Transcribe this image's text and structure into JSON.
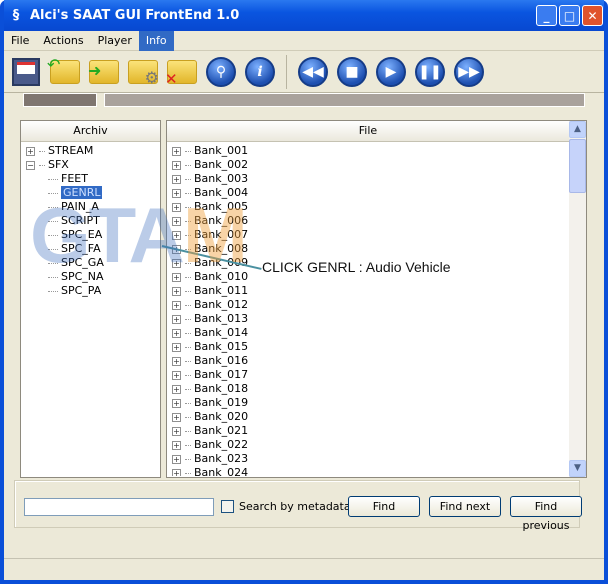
{
  "window": {
    "title": "Alci's SAAT GUI FrontEnd 1.0"
  },
  "menu": [
    "File",
    "Actions",
    "Player",
    "Info"
  ],
  "menu_active": "Info",
  "toolbar": [
    "save-icon",
    "open-folder-icon",
    "folder-arrow-icon",
    "folder-settings-icon",
    "folder-delete-icon",
    "search-icon",
    "info-icon",
    "rewind-icon",
    "stop-icon",
    "play-icon",
    "pause-icon",
    "fast-forward-icon"
  ],
  "archive": {
    "header": "Archiv",
    "items": [
      {
        "label": "STREAM",
        "level": 0,
        "toggle": "+"
      },
      {
        "label": "SFX",
        "level": 0,
        "toggle": "-"
      },
      {
        "label": "FEET",
        "level": 1
      },
      {
        "label": "GENRL",
        "level": 1,
        "selected": true
      },
      {
        "label": "PAIN_A",
        "level": 1
      },
      {
        "label": "SCRIPT",
        "level": 1
      },
      {
        "label": "SPC_EA",
        "level": 1
      },
      {
        "label": "SPC_FA",
        "level": 1
      },
      {
        "label": "SPC_GA",
        "level": 1
      },
      {
        "label": "SPC_NA",
        "level": 1
      },
      {
        "label": "SPC_PA",
        "level": 1
      }
    ]
  },
  "files": {
    "header": "File",
    "items": [
      "Bank_001",
      "Bank_002",
      "Bank_003",
      "Bank_004",
      "Bank_005",
      "Bank_006",
      "Bank_007",
      "Bank_008",
      "Bank_009",
      "Bank_010",
      "Bank_011",
      "Bank_012",
      "Bank_013",
      "Bank_014",
      "Bank_015",
      "Bank_016",
      "Bank_017",
      "Bank_018",
      "Bank_019",
      "Bank_020",
      "Bank_021",
      "Bank_022",
      "Bank_023",
      "Bank_024"
    ]
  },
  "search": {
    "value": "",
    "checkbox_label": "Search by metadata",
    "checked": false,
    "find": "Find",
    "find_next": "Find next",
    "find_previous": "Find previous"
  },
  "annotation": "CLICK GENRL : Audio Vehicle",
  "watermark": "GTAM",
  "colors": {
    "titlebar": "#0a4fd8",
    "selection": "#316ac5",
    "face": "#ece9d8"
  }
}
